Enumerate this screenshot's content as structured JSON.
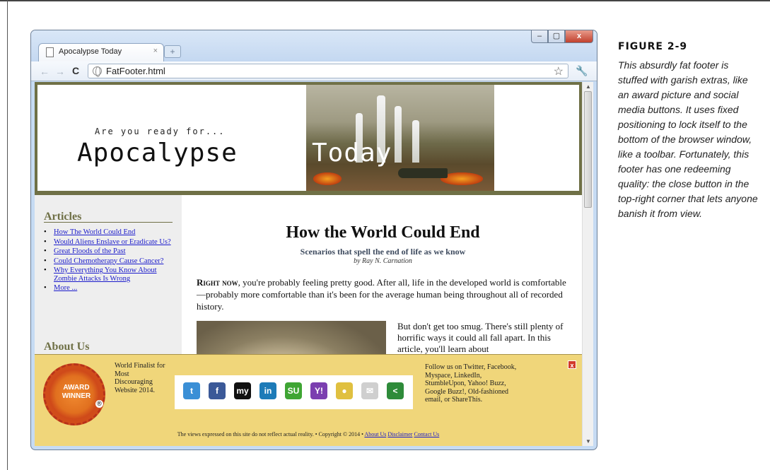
{
  "browser": {
    "tab_title": "Apocalypse Today",
    "tab_close": "×",
    "url": "FatFooter.html",
    "win_min": "–",
    "win_max": "▢",
    "win_close": "x"
  },
  "header": {
    "tagline": "Are you ready for...",
    "logo_left": "Apocalypse",
    "logo_right": "Today"
  },
  "sidebar": {
    "articles_heading": "Articles",
    "items": [
      {
        "label": "How The World Could End"
      },
      {
        "label": "Would Aliens Enslave or Eradicate Us?"
      },
      {
        "label": "Great Floods of the Past"
      },
      {
        "label": "Could Chemotherapy Cause Cancer?"
      },
      {
        "label": "Why Everything You Know About Zombie Attacks Is Wrong"
      },
      {
        "label": "More ..."
      }
    ],
    "about_heading": "About Us"
  },
  "article": {
    "title": "How the World Could End",
    "subtitle": "Scenarios that spell the end of life as we know",
    "byline": "by Ray N. Carnation",
    "para1_lead": "Right now",
    "para1_rest": ", you're probably feeling pretty good. After all, life in the developed world is comfortable—probably more comfortable than it's been for the average human being throughout all of recorded history.",
    "para2": "But don't get too smug. There's still plenty of horrific ways it could all fall apart. In this article, you'll learn about"
  },
  "footer": {
    "award_badge": "AWARD WINNER",
    "award_reg": "®",
    "award_text": "World Finalist for Most Discouraging Website 2014.",
    "social_icons": [
      {
        "name": "twitter-icon",
        "glyph": "t",
        "color": "#3a8fd6"
      },
      {
        "name": "facebook-icon",
        "glyph": "f",
        "color": "#3b5998"
      },
      {
        "name": "myspace-icon",
        "glyph": "my",
        "color": "#111111"
      },
      {
        "name": "linkedin-icon",
        "glyph": "in",
        "color": "#1d7bb8"
      },
      {
        "name": "stumbleupon-icon",
        "glyph": "SU",
        "color": "#3fa534"
      },
      {
        "name": "yahoo-buzz-icon",
        "glyph": "Y!",
        "color": "#7b3fb0"
      },
      {
        "name": "google-buzz-icon",
        "glyph": "●",
        "color": "#e0c040"
      },
      {
        "name": "email-icon",
        "glyph": "✉",
        "color": "#cfcfcf"
      },
      {
        "name": "sharethis-icon",
        "glyph": "<",
        "color": "#2e8b3a"
      }
    ],
    "follow_text": "Follow us on Twitter, Facebook, Myspace, LinkedIn, StumbleUpon, Yahoo! Buzz, Google Buzz!, Old-fashioned email, or ShareThis.",
    "close_glyph": "x",
    "disclaimer": "The views expressed on this site do not reflect actual reality.",
    "separator": "•",
    "copyright": "Copyright © 2014",
    "links": [
      "About Us",
      "Disclaimer",
      "Contact Us"
    ]
  },
  "figure": {
    "label": "FIGURE 2-9",
    "caption": "This absurdly fat footer is stuffed with garish extras, like an award picture and social media buttons. It uses fixed positioning to lock itself to the bottom of the browser window, like a toolbar. Fortunately, this footer has one redeeming quality: the close button in the top-right corner that lets anyone banish it from view."
  }
}
